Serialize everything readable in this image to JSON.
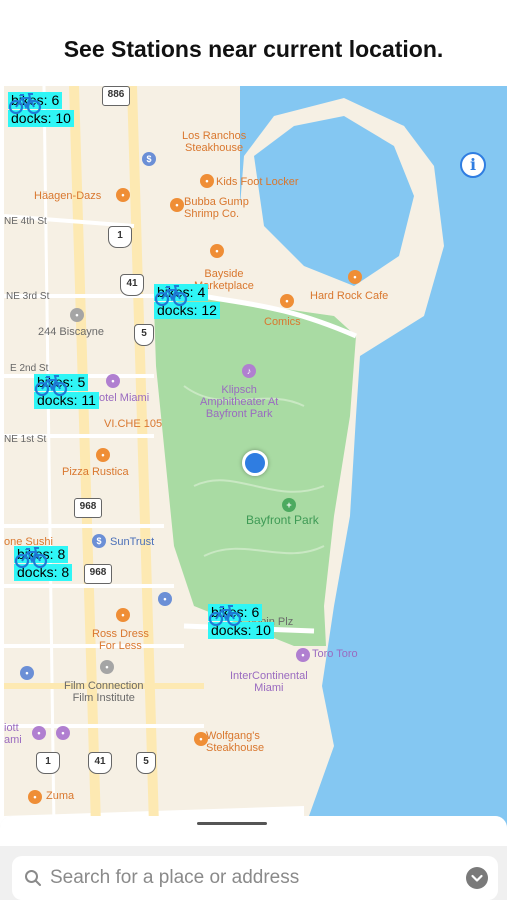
{
  "headline": "See Stations near current location.",
  "map": {
    "pois": {
      "los_ranchos": "Los Ranchos\nSteakhouse",
      "haagen_dazs": "Häagen-Dazs",
      "kids_foot_locker": "Kids Foot Locker",
      "bubba_gump": "Bubba Gump\nShrimp Co.",
      "bayside": "Bayside\nMarketplace",
      "hard_rock": "Hard Rock Cafe",
      "comics": "Comics",
      "biscayne_244": "244 Biscayne",
      "klipsch": "Klipsch\nAmphitheater At\nBayfront Park",
      "hotel_miami": "YVE Hotel Miami",
      "vi_che": "VI.CHE 105",
      "pizza_rustica": "Pizza Rustica",
      "bayfront_park": "Bayfront Park",
      "one_sushi": "one Sushi",
      "suntrust": "SunTrust",
      "ross": "Ross Dress\nFor Less",
      "film_connection": "Film Connection\nFilm Institute",
      "chopin": "Chopin Plz",
      "toro_toro": "Toro Toro",
      "intercontinental": "InterContinental\nMiami",
      "wolfgangs": "Wolfgang's\nSteakhouse",
      "zuma": "Zuma",
      "iott": "iott\nami"
    },
    "streets": {
      "ne4": "NE 4th St",
      "ne3": "NE 3rd St",
      "ne2": "E 2nd St",
      "ne1": "NE 1st St"
    },
    "shields": [
      "886",
      "1",
      "41",
      "5",
      "968",
      "968",
      "1",
      "41",
      "5"
    ],
    "stations": [
      {
        "bikes": "bikes: 6",
        "docks": "docks: 10"
      },
      {
        "bikes": "bikes: 4",
        "docks": "docks: 12"
      },
      {
        "bikes": "bikes: 5",
        "docks": "docks: 11"
      },
      {
        "bikes": "bikes: 8",
        "docks": "docks: 8"
      },
      {
        "bikes": "bikes: 6",
        "docks": "docks: 10"
      }
    ],
    "info_button": "i"
  },
  "search": {
    "placeholder": "Search for a place or address"
  },
  "colors": {
    "station_label": "#2ff6f6",
    "water": "#84c7f2",
    "park": "#a9dba3",
    "accent": "#2f7de1"
  }
}
